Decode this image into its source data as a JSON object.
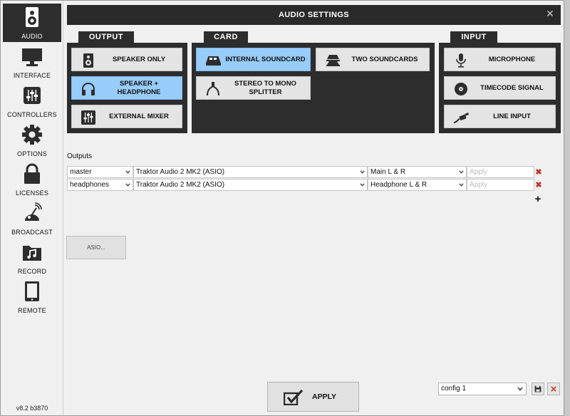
{
  "sidebar": {
    "items": [
      {
        "label": "AUDIO",
        "icon": "speaker-icon",
        "active": true
      },
      {
        "label": "INTERFACE",
        "icon": "monitor-icon"
      },
      {
        "label": "CONTROLLERS",
        "icon": "mixer-sliders-icon"
      },
      {
        "label": "OPTIONS",
        "icon": "gear-icon"
      },
      {
        "label": "LICENSES",
        "icon": "lock-icon"
      },
      {
        "label": "BROADCAST",
        "icon": "broadcast-antenna-icon"
      },
      {
        "label": "RECORD",
        "icon": "music-folder-icon"
      },
      {
        "label": "REMOTE",
        "icon": "tablet-icon"
      }
    ],
    "version": "v8.2 b3870"
  },
  "title": "AUDIO SETTINGS",
  "close_glyph": "✕",
  "groups": {
    "output": {
      "label": "OUTPUT",
      "buttons": [
        {
          "label": "SPEAKER ONLY",
          "icon": "speaker-icon",
          "selected": false
        },
        {
          "label": "SPEAKER + HEADPHONE",
          "icon": "headphones-icon",
          "selected": true
        },
        {
          "label": "EXTERNAL MIXER",
          "icon": "mixer-sliders-icon",
          "selected": false
        }
      ]
    },
    "card": {
      "label": "CARD",
      "buttons": [
        {
          "label": "INTERNAL SOUNDCARD",
          "icon": "soundcard-icon",
          "selected": true
        },
        {
          "label": "TWO SOUNDCARDS",
          "icon": "two-soundcards-icon",
          "selected": false
        },
        {
          "label": "STEREO TO MONO SPLITTER",
          "icon": "splitter-cable-icon",
          "selected": false
        }
      ]
    },
    "input": {
      "label": "INPUT",
      "buttons": [
        {
          "label": "MICROPHONE",
          "icon": "microphone-icon",
          "selected": false
        },
        {
          "label": "TIMECODE SIGNAL",
          "icon": "vinyl-icon",
          "selected": false
        },
        {
          "label": "LINE INPUT",
          "icon": "jack-cable-icon",
          "selected": false
        }
      ]
    }
  },
  "outputs": {
    "label": "Outputs",
    "rows": [
      {
        "output": "master",
        "device": "Traktor Audio 2 MK2 (ASIO)",
        "channels": "Main L & R",
        "apply_placeholder": "Apply"
      },
      {
        "output": "headphones",
        "device": "Traktor Audio 2 MK2 (ASIO)",
        "channels": "Headphone L & R",
        "apply_placeholder": "Apply"
      }
    ],
    "delete_glyph": "✖",
    "add_glyph": "+"
  },
  "asio_button_label": "ASIO...",
  "apply_label": "APPLY",
  "config": {
    "value": "config 1"
  },
  "colors": {
    "selected": "#98ccf9",
    "panel": "#2d2d2d",
    "delete": "#c0392b"
  }
}
